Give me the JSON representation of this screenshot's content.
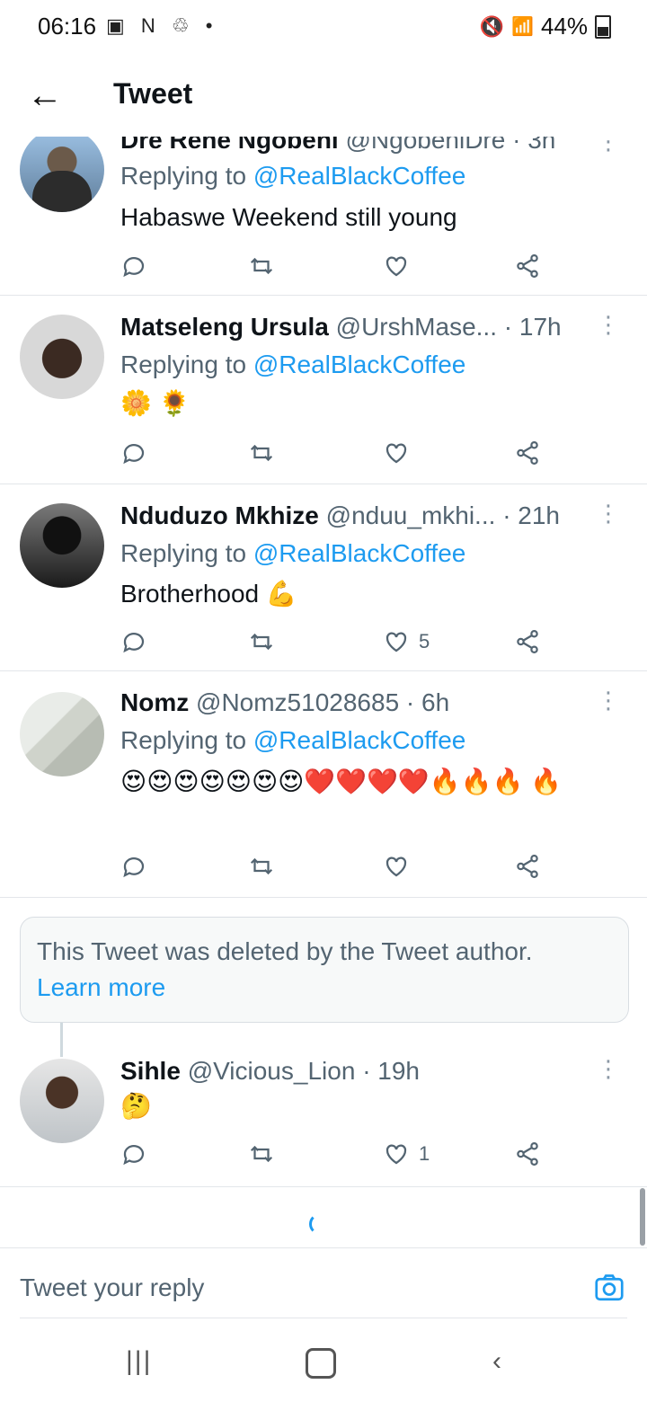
{
  "status_bar": {
    "time": "06:16",
    "battery": "44%"
  },
  "header": {
    "title": "Tweet"
  },
  "tweets": [
    {
      "name": "Dre Rene Ngobeni",
      "handle": "@NgobeniDre",
      "time": "· 3h",
      "reply_to_prefix": "Replying to",
      "reply_to": "@RealBlackCoffee",
      "text": "Habaswe Weekend still young",
      "likes": ""
    },
    {
      "name": "Matseleng Ursula",
      "handle": "@UrshMase...",
      "time": "· 17h",
      "reply_to_prefix": "Replying to",
      "reply_to": "@RealBlackCoffee",
      "text": "🌼 🌻",
      "likes": ""
    },
    {
      "name": "Nduduzo Mkhize",
      "handle": "@nduu_mkhi...",
      "time": "· 21h",
      "reply_to_prefix": "Replying to",
      "reply_to": "@RealBlackCoffee",
      "text": "Brotherhood 💪",
      "likes": "5"
    },
    {
      "name": "Nomz",
      "handle": "@Nomz51028685",
      "time": "· 6h",
      "reply_to_prefix": "Replying to",
      "reply_to": "@RealBlackCoffee",
      "text": "😍😍😍😍😍😍😍❤️❤️❤️❤️🔥🔥🔥 🔥",
      "likes": ""
    },
    {
      "name": "Sihle",
      "handle": "@Vicious_Lion",
      "time": "· 19h",
      "reply_to_prefix": "",
      "reply_to": "",
      "text": "🤔",
      "likes": "1"
    }
  ],
  "deleted_notice": {
    "text": "This Tweet was deleted by the Tweet author.",
    "link": "Learn more"
  },
  "composer": {
    "placeholder": "Tweet your reply"
  },
  "colors": {
    "accent": "#1d9bf0",
    "muted": "#536471"
  }
}
